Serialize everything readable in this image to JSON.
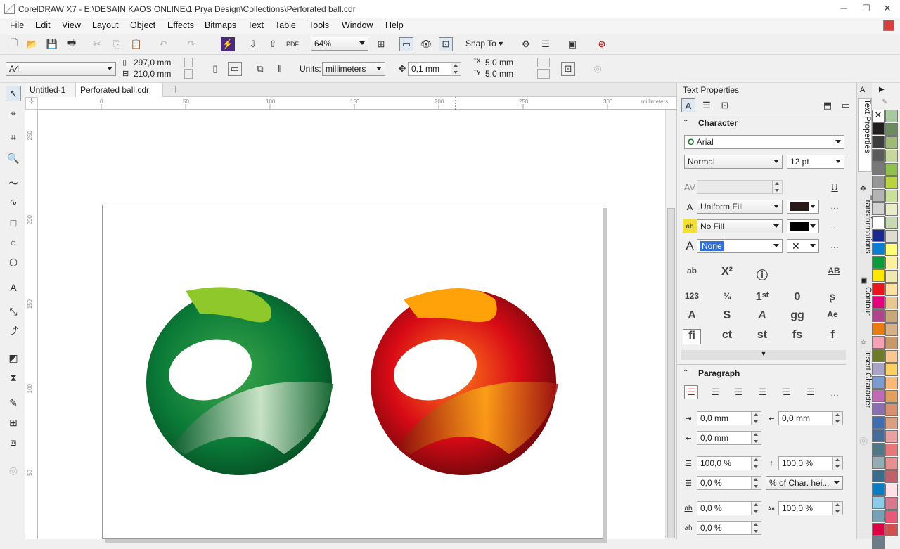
{
  "window": {
    "title": "CorelDRAW X7 - E:\\DESAIN KAOS ONLINE\\1 Prya Design\\Collections\\Perforated ball.cdr"
  },
  "menu": [
    "File",
    "Edit",
    "View",
    "Layout",
    "Object",
    "Effects",
    "Bitmaps",
    "Text",
    "Table",
    "Tools",
    "Window",
    "Help"
  ],
  "standard_toolbar": {
    "zoom": "64%",
    "snap_to": "Snap To"
  },
  "property_bar": {
    "page_size": "A4",
    "width": "297,0 mm",
    "height": "210,0 mm",
    "units_label": "Units:",
    "units": "millimeters",
    "nudge": "0,1 mm",
    "dup_x": "5,0 mm",
    "dup_y": "5,0 mm"
  },
  "doc_tabs": [
    "Untitled-1",
    "Perforated ball.cdr"
  ],
  "ruler": {
    "h_ticks": [
      "0",
      "50",
      "100",
      "150",
      "200",
      "250",
      "300"
    ],
    "unit": "millimeters",
    "v_ticks": [
      "250",
      "200",
      "150",
      "100",
      "50"
    ]
  },
  "panel": {
    "title": "Text Properties",
    "character": {
      "header": "Character",
      "font": "Arial",
      "style": "Normal",
      "size": "12 pt",
      "fill": "Uniform Fill",
      "bg_fill": "No Fill",
      "outline": "None"
    },
    "char_glyphs": [
      "ab",
      "X²",
      "ⓘ",
      "AB",
      "123",
      "¼",
      "1ˢᵗ",
      "0",
      "ʂ",
      "A",
      "S",
      "A",
      "gg",
      "Ae",
      "fi",
      "ct",
      "st",
      "fs",
      "f"
    ],
    "paragraph": {
      "header": "Paragraph",
      "left_indent": "0,0 mm",
      "first_indent": "0,0 mm",
      "right_indent": "0,0 mm",
      "before_para": "100,0 %",
      "before_line": "100,0 %",
      "after_para": "0,0 %",
      "spacing_unit": "% of Char. hei...",
      "char_spacing": "0,0 %",
      "word_spacing": "100,0 %",
      "lang_spacing": "0,0 %"
    }
  },
  "dock_tabs": [
    "Text Properties",
    "Transformations",
    "Contour",
    "Insert Character"
  ],
  "palette_left": [
    "#1e1e1e",
    "#3c3c3c",
    "#5a5a5a",
    "#787878",
    "#969696",
    "#b4b4b4",
    "#d2d2d2",
    "#ffffff",
    "#1a2a8c",
    "#0a7fd0",
    "#0e9a3c",
    "#ffe600",
    "#e8141e",
    "#e4007c",
    "#b0448c",
    "#e87c0e",
    "#f5a0b4",
    "#6c7c28",
    "#a8a4c8",
    "#7c9cd0",
    "#c06cb4",
    "#8870b0",
    "#406cb0",
    "#486c98",
    "#507888",
    "#96acb4",
    "#3c6c8c",
    "#0a7cc4",
    "#8ccce8",
    "#78a0b4",
    "#dc0044",
    "#6c7c88"
  ],
  "palette_right": [
    "#a8c8a0",
    "#6c8c60",
    "#a0b878",
    "#c8d89c",
    "#90c050",
    "#b8d440",
    "#c8e098",
    "#e8ecc8",
    "#c8d8b0",
    "#dcdcd0",
    "#ffff78",
    "#fff0a0",
    "#f0e8b0",
    "#ffe0a0",
    "#e8c890",
    "#c8a878",
    "#d8b088",
    "#c89868",
    "#f8c890",
    "#fcd060",
    "#f8b878",
    "#e0a060",
    "#d89070",
    "#d8a080",
    "#e8a0a0",
    "#e87878",
    "#e89090",
    "#c06068",
    "#ffe0e8",
    "#d87890",
    "#e85878",
    "#d05050"
  ]
}
